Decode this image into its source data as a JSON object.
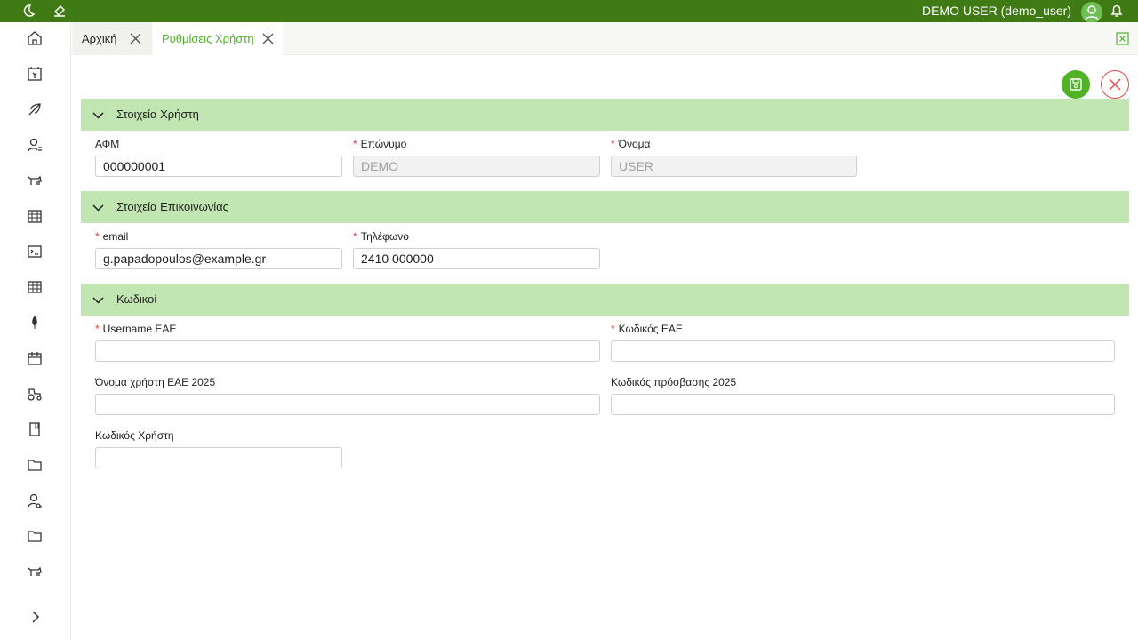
{
  "topbar": {
    "user_label": "DEMO USER (demo_user)",
    "icons": [
      "moon-icon",
      "brush-icon",
      "user-avatar-icon",
      "bell-icon"
    ],
    "bg_color": "#3f7a14"
  },
  "sidebar": {
    "icons": [
      "home-icon",
      "invoice-calendar-icon",
      "leaf-icon",
      "user-settings-icon",
      "cow-icon",
      "warehouse-icon",
      "terminal-icon",
      "table-icon",
      "fertilizer-icon",
      "calendar-icon",
      "tractor-icon",
      "book-icon",
      "folder-icon",
      "user-search-icon",
      "folder-icon",
      "cow-icon"
    ],
    "expand_icon": "chevron-right-icon"
  },
  "tabs": [
    {
      "label": "Αρχική",
      "active": false
    },
    {
      "label": "Ρυθμίσεις Χρήστη",
      "active": true
    }
  ],
  "sections": {
    "user": {
      "title": "Στοιχεία Χρήστη",
      "afm_label": "ΑΦΜ",
      "afm_value": "000000001",
      "surname_label": "Επώνυμο",
      "surname_value": "DEMO",
      "name_label": "Όνομα",
      "name_value": "USER"
    },
    "contact": {
      "title": "Στοιχεία Επικοινωνίας",
      "email_label": "email",
      "email_value": "g.papadopoulos@example.gr",
      "phone_label": "Τηλέφωνο",
      "phone_value": "2410 000000"
    },
    "codes": {
      "title": "Κωδικοί",
      "username_eae_label": "Username ΕΑΕ",
      "username_eae_value": "",
      "password_eae_label": "Κωδικός ΕΑΕ",
      "password_eae_value": "",
      "username_eae_2025_label": "Όνομα χρήστη ΕΑΕ 2025",
      "username_eae_2025_value": "",
      "password_2025_label": "Κωδικός πρόσβασης 2025",
      "password_2025_value": "",
      "user_code_label": "Κωδικός Χρήστη",
      "user_code_value": ""
    }
  },
  "colors": {
    "accent": "#4fb325",
    "section_bg": "#c2e6b1",
    "required": "#e23b3b",
    "close": "#e84a4a"
  }
}
